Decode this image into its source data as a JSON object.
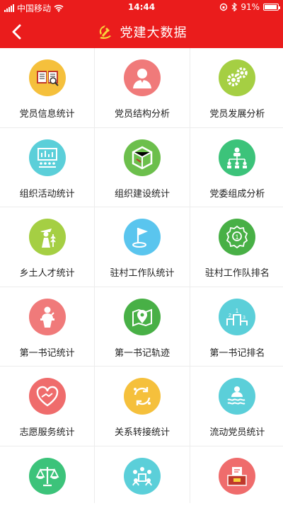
{
  "status_bar": {
    "carrier": "中国移动",
    "time": "14:44",
    "battery": "91%"
  },
  "header": {
    "title": "党建大数据"
  },
  "colors": {
    "header_red": "#ea1c1c"
  },
  "items": [
    {
      "label": "党员信息统计",
      "icon": "book-magnifier-icon",
      "color": "#f5c03c"
    },
    {
      "label": "党员结构分析",
      "icon": "person-bust-icon",
      "color": "#f07a7a"
    },
    {
      "label": "党员发展分析",
      "icon": "gears-icon",
      "color": "#a5cf43"
    },
    {
      "label": "组织活动统计",
      "icon": "presentation-board-icon",
      "color": "#5bcfd9"
    },
    {
      "label": "组织建设统计",
      "icon": "party-cube-icon",
      "color": "#6cbf4c"
    },
    {
      "label": "党委组成分析",
      "icon": "org-chart-icon",
      "color": "#3cc37a"
    },
    {
      "label": "乡土人才统计",
      "icon": "farmer-icon",
      "color": "#a5cf43"
    },
    {
      "label": "驻村工作队统计",
      "icon": "flag-marker-icon",
      "color": "#5ac5ee"
    },
    {
      "label": "驻村工作队排名",
      "icon": "medal-icon",
      "color": "#48b046"
    },
    {
      "label": "第一书记统计",
      "icon": "speaker-podium-icon",
      "color": "#f07a7a"
    },
    {
      "label": "第一书记轨迹",
      "icon": "map-pin-icon",
      "color": "#48b046"
    },
    {
      "label": "第一书记排名",
      "icon": "podium-icon",
      "color": "#5bcfd9"
    },
    {
      "label": "志愿服务统计",
      "icon": "heart-hands-icon",
      "color": "#ef6c6c"
    },
    {
      "label": "关系转接统计",
      "icon": "transfer-cycle-icon",
      "color": "#f5c03c"
    },
    {
      "label": "流动党员统计",
      "icon": "swimming-person-icon",
      "color": "#5bcfd9"
    },
    {
      "label": "",
      "icon": "balance-scale-icon",
      "color": "#3cc37a"
    },
    {
      "label": "",
      "icon": "group-meeting-icon",
      "color": "#5bcfd9"
    },
    {
      "label": "",
      "icon": "ballot-box-icon",
      "color": "#ef6c6c"
    }
  ]
}
